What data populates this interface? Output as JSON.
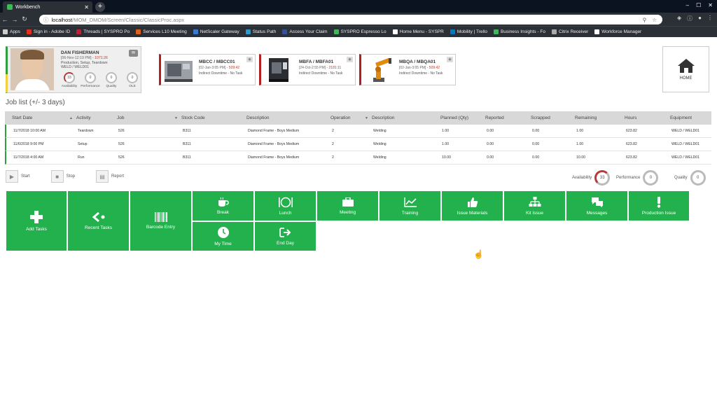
{
  "browser": {
    "tab_title": "Workbench",
    "url_host": "localhost",
    "url_path": "/MOM_DMOM/Screen/Classic/ClassicProc.aspx",
    "bookmarks": [
      {
        "label": "Apps",
        "color": "#cccccc"
      },
      {
        "label": "Sign in - Adobe ID",
        "color": "#e03020"
      },
      {
        "label": "Threads | SYSPRO Po",
        "color": "#c02030"
      },
      {
        "label": "Services L10 Meeting",
        "color": "#e06020"
      },
      {
        "label": "NetScaler Gateway",
        "color": "#3a7ad0"
      },
      {
        "label": "Status Path",
        "color": "#2a9ad0"
      },
      {
        "label": "Access Your Claim",
        "color": "#3050a0"
      },
      {
        "label": "SYSPRO Espresso Lo",
        "color": "#3cba54"
      },
      {
        "label": "Home Menu - SYSPR",
        "color": "#ffffff"
      },
      {
        "label": "Mobility | Trello",
        "color": "#0079bf"
      },
      {
        "label": "Business Insights - Fo",
        "color": "#3cba54"
      },
      {
        "label": "Citrix Receiver",
        "color": "#aaaaaa"
      },
      {
        "label": "Workforce Manager",
        "color": "#ffffff"
      }
    ]
  },
  "operator": {
    "name": "DAN FISHERMAN",
    "date": "[06-Nov-12:19 PM]",
    "timer": "1071:26",
    "activities": "Production, Setup, Teardown",
    "equipment": "WELD / WELD01",
    "kpis": [
      {
        "label": "Availability",
        "value": "33"
      },
      {
        "label": "Performance",
        "value": "0"
      },
      {
        "label": "Quality",
        "value": "0"
      },
      {
        "label": "OLE",
        "value": "0"
      }
    ]
  },
  "machines": [
    {
      "name": "MBCC / MBCC01",
      "date": "[02-Jan-3:05 PM] -",
      "timer": "509:42",
      "status": "Indirect Downtime - No Task"
    },
    {
      "name": "MBFA / MBFA01",
      "date": "[24-Oct-2:55 PM] -",
      "timer": "2181:11",
      "status": "Indirect Downtime - No Task"
    },
    {
      "name": "MBQA / MBQA01",
      "date": "[02-Jan-3:05 PM] -",
      "timer": "509:42",
      "status": "Indirect Downtime - No Task"
    }
  ],
  "home_label": "HOME",
  "joblist_title": "Job list (+/- 3 days)",
  "table": {
    "headers": [
      "Start Date",
      "Activity",
      "Job",
      "Stock Code",
      "Description",
      "Operation",
      "Description",
      "Planned (Qty)",
      "Reported",
      "Scrapped",
      "Remaining",
      "Hours",
      "Equipment"
    ],
    "rows": [
      [
        "11/7/2018 10:00 AM",
        "Teardown",
        "526",
        "B311",
        "Diamond Frame - Boys Medium",
        "2",
        "Welding",
        "1.00",
        "0.00",
        "0.00",
        "1.00",
        "623.82",
        "WELD / WELD01"
      ],
      [
        "11/6/2018 9:00 PM",
        "Setup",
        "526",
        "B311",
        "Diamond Frame - Boys Medium",
        "2",
        "Welding",
        "1.00",
        "0.00",
        "0.00",
        "1.00",
        "623.82",
        "WELD / WELD01"
      ],
      [
        "11/7/2018 4:00 AM",
        "Run",
        "526",
        "B311",
        "Diamond Frame - Boys Medium",
        "2",
        "Welding",
        "10.00",
        "0.00",
        "0.00",
        "10.00",
        "623.82",
        "WELD / WELD01"
      ]
    ]
  },
  "actions": {
    "start": "Start",
    "stop": "Stop",
    "report": "Report"
  },
  "perf": {
    "availability_label": "Availability",
    "availability_value": "33",
    "performance_label": "Performance",
    "performance_value": "0",
    "quality_label": "Quality",
    "quality_value": "0"
  },
  "tiles": {
    "add_tasks": "Add Tasks",
    "recent_tasks": "Recent Tasks",
    "barcode_entry": "Barcode Entry",
    "break": "Break",
    "lunch": "Lunch",
    "meeting": "Meeting",
    "training": "Training",
    "issue_materials": "Issue Materials",
    "kit_issue": "Kit Issue",
    "messages": "Messages",
    "production_issue": "Production Issue",
    "my_time": "My Time",
    "end_day": "End Day"
  },
  "colors": {
    "tile_green": "#22b14c",
    "status_red": "#b02020",
    "status_green": "#2e9e3e"
  }
}
